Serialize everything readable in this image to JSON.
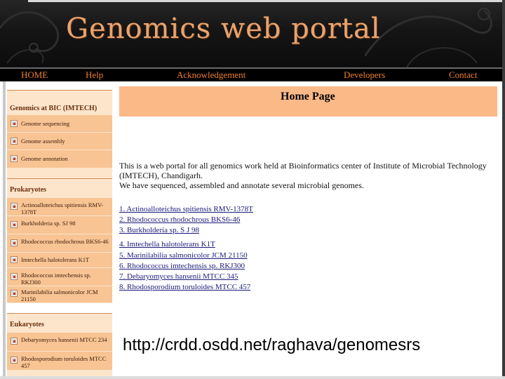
{
  "header": {
    "title": "Genomics web portal"
  },
  "nav": {
    "items": [
      "HOME",
      "Help",
      "Acknowledgement",
      "Developers",
      "Contact"
    ]
  },
  "sidebar": {
    "sections": [
      {
        "title": "Genomics at BIC (IMTECH)",
        "items": [
          "Genome sequencing",
          "Genome assembly",
          "Genome annotation"
        ]
      },
      {
        "title": "Prokaryotes",
        "items": [
          "Actinoalloteichus spitiensis RMV-1378T",
          "Burkholderia sp. SJ 98",
          "Rhodococcus rhodochrous BKS6-46",
          "Imtechella halotolerans K1T",
          "Rhodococcus imtechensis sp. RKJ300",
          "Marinilabilia salmonicolor JCM 21150"
        ]
      },
      {
        "title": "Eukaryotes",
        "items": [
          "Debaryomyces hansenii MTCC 234",
          "Rhodosporodium toruloides MTCC 457"
        ]
      }
    ]
  },
  "main": {
    "heading": "Home Page",
    "intro_1": "This is a web portal for all genomics work held at Bioinformatics center of Institute of Microbial Technology (IMTECH), Chandigarh.",
    "intro_2": "We have sequenced, assembled and annotate several microbial genomes.",
    "genomes": [
      "1. Actinoalloteichus spitiensis RMV-1378T",
      "2. Rhodococcus rhodochrous BKS6-46",
      "3. Burkholderia sp. S J 98",
      "4. Imtechella halotolerans K1T",
      "5. Marinilabilia salmonicolor JCM 21150",
      "6. Rhodococcus imtechensis sp. RKJ300",
      "7. Debaryomyces hansenii MTCC 345",
      "8. Rhodosporodium toruloides MTCC 457"
    ]
  },
  "overlay_url": "http://crdd.osdd.net/raghava/genomesrs"
}
